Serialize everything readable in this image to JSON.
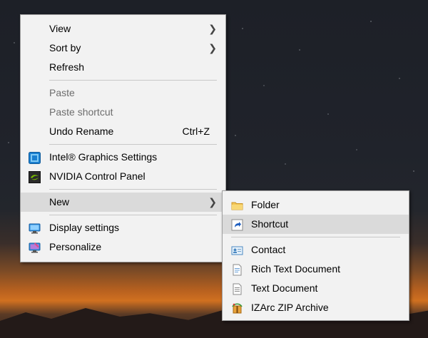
{
  "main_menu": {
    "view": "View",
    "sort_by": "Sort by",
    "refresh": "Refresh",
    "paste": "Paste",
    "paste_shortcut": "Paste shortcut",
    "undo_rename": "Undo Rename",
    "undo_rename_key": "Ctrl+Z",
    "intel_graphics": "Intel® Graphics Settings",
    "nvidia_panel": "NVIDIA Control Panel",
    "new": "New",
    "display_settings": "Display settings",
    "personalize": "Personalize"
  },
  "new_submenu": {
    "folder": "Folder",
    "shortcut": "Shortcut",
    "contact": "Contact",
    "rich_text": "Rich Text Document",
    "text_doc": "Text Document",
    "izarc": "IZArc ZIP Archive"
  },
  "icons": {
    "intel": "intel-graphics-icon",
    "nvidia": "nvidia-icon",
    "display": "display-settings-icon",
    "personalize": "personalize-icon",
    "folder": "folder-icon",
    "shortcut": "shortcut-icon",
    "contact": "contact-icon",
    "rich_text": "rich-text-document-icon",
    "text": "text-document-icon",
    "izarc": "izarc-archive-icon"
  },
  "colors": {
    "menu_bg": "#f2f2f2",
    "highlight": "#dadada",
    "disabled_text": "#6d6d6d"
  }
}
